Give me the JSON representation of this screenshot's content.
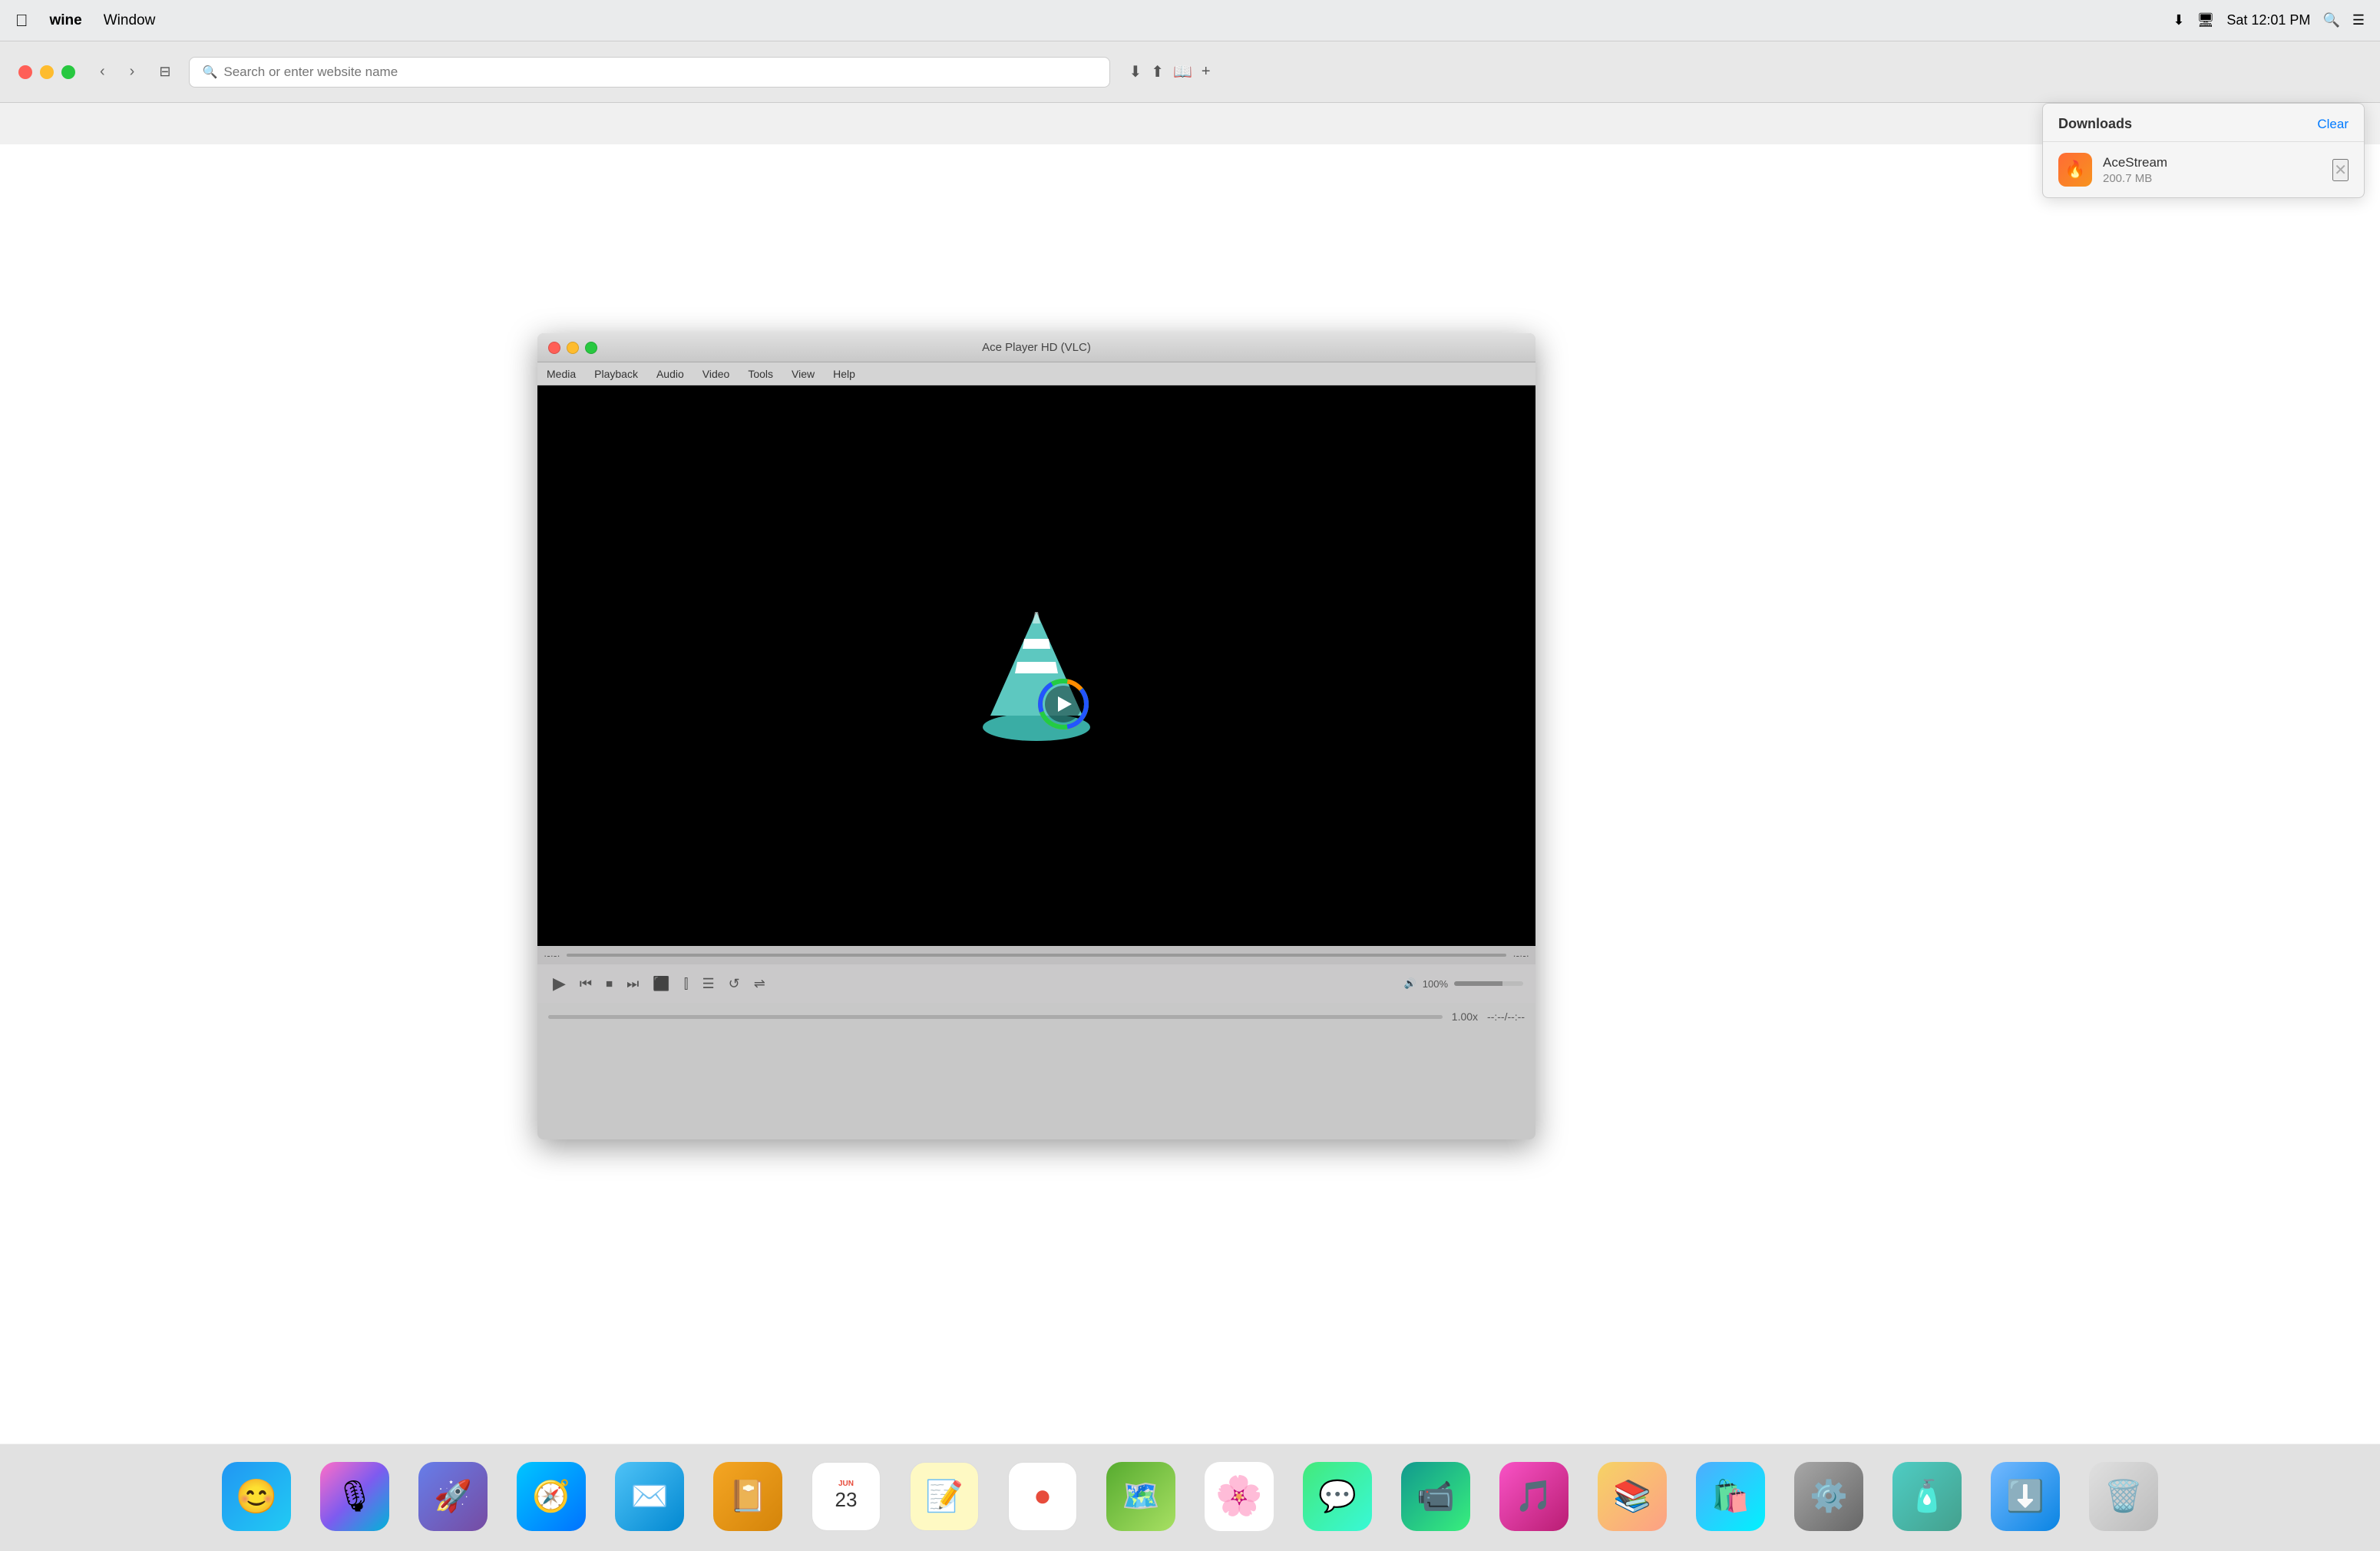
{
  "menubar": {
    "apple_label": "",
    "app_name": "wine",
    "window_menu": "Window",
    "time": "Sat 12:01 PM"
  },
  "browser": {
    "toolbar": {
      "back_label": "‹",
      "forward_label": "›",
      "sidebar_label": "⊟",
      "search_placeholder": "Search or enter website name",
      "download_btn": "⬇",
      "share_btn": "⬆",
      "add_tab_btn": "+"
    }
  },
  "downloads": {
    "title": "Downloads",
    "clear_label": "Clear",
    "items": [
      {
        "name": "AceStream",
        "size": "200.7 MB",
        "icon": "🔥"
      }
    ]
  },
  "vlc": {
    "title": "Ace Player HD (VLC)",
    "menu": {
      "items": [
        "Media",
        "Playback",
        "Audio",
        "Video",
        "Tools",
        "View",
        "Help"
      ]
    },
    "controls": {
      "play": "▶",
      "prev": "⏮",
      "stop": "⏹",
      "next": "⏭",
      "frame": "⬛",
      "eq": "≣",
      "playlist": "☰",
      "loop": "↺",
      "shuffle": "⇌"
    },
    "volume": "100%",
    "speed": "1.00x",
    "time": "--:--/--:--",
    "progress_left": "·-·-·",
    "progress_right": "·-·-·"
  },
  "dock": {
    "items": [
      {
        "id": "finder",
        "emoji": "🖥️",
        "label": ""
      },
      {
        "id": "siri",
        "emoji": "🎙️",
        "label": ""
      },
      {
        "id": "rocket",
        "emoji": "🚀",
        "label": ""
      },
      {
        "id": "safari",
        "emoji": "🧭",
        "label": ""
      },
      {
        "id": "mail",
        "emoji": "✉️",
        "label": ""
      },
      {
        "id": "contacts",
        "emoji": "📔",
        "label": ""
      },
      {
        "id": "calendar",
        "month": "JUN",
        "date": "23",
        "label": ""
      },
      {
        "id": "notes",
        "emoji": "📝",
        "label": ""
      },
      {
        "id": "reminders",
        "emoji": "⚪",
        "label": ""
      },
      {
        "id": "maps",
        "emoji": "🗺️",
        "label": ""
      },
      {
        "id": "photos",
        "emoji": "🌸",
        "label": ""
      },
      {
        "id": "messages",
        "emoji": "💬",
        "label": ""
      },
      {
        "id": "facetime",
        "emoji": "📹",
        "label": ""
      },
      {
        "id": "itunes",
        "emoji": "🎵",
        "label": ""
      },
      {
        "id": "books",
        "emoji": "📚",
        "label": ""
      },
      {
        "id": "appstore",
        "emoji": "🛍️",
        "label": ""
      },
      {
        "id": "syspref",
        "emoji": "⚙️",
        "label": ""
      },
      {
        "id": "wine",
        "emoji": "🧴",
        "label": ""
      },
      {
        "id": "downloads",
        "emoji": "⬇️",
        "label": ""
      },
      {
        "id": "trash",
        "emoji": "🗑️",
        "label": ""
      }
    ]
  }
}
